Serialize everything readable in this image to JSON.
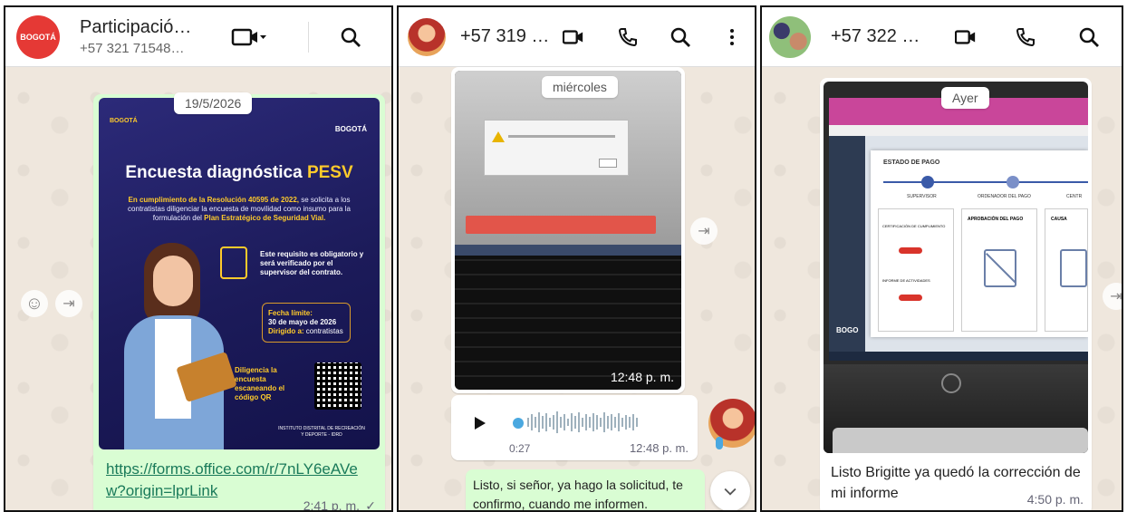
{
  "panel1": {
    "contact_name": "Participació…",
    "contact_phone": "+57 321 71548…",
    "date_pill": "19/5/2026",
    "poster": {
      "logo_text": "BOGOTÁ",
      "title_prefix": "Encuesta diagnóstica",
      "title_accent": "PESV",
      "body_1": "En cumplimiento de la Resolución 40595 de 2022,",
      "body_2": "se solicita a los contratistas diligenciar la encuesta de movilidad como insumo para la formulación del",
      "body_3": "Plan Estratégico de Seguridad Vial.",
      "req_text": "Este requisito es obligatorio y será verificado por el supervisor del contrato.",
      "deadline_label": "Fecha límite:",
      "deadline_value": "30 de mayo de 2026",
      "audience_label": "Dirigido a:",
      "audience_value": "contratistas",
      "qr_caption": "Diligencia la encuesta escaneando el código QR",
      "institute": "INSTITUTO DISTRITAL DE RECREACIÓN Y DEPORTE - IDRD"
    },
    "link_text": "https://forms.office.com/r/7nLY6eAVew?origin=lprLink",
    "link_time": "2:41 p. m.",
    "read_mark": "✓"
  },
  "panel2": {
    "contact_phone": "+57 319 …",
    "date_pill": "miércoles",
    "photo_time": "12:48 p. m.",
    "voice_duration": "0:27",
    "voice_time": "12:48 p. m.",
    "message": "Listo, si señor, ya hago la solicitud, te confirmo, cuando me informen."
  },
  "panel3": {
    "contact_phone": "+57 322 …",
    "date_pill": "Ayer",
    "screen_title": "ESTADO DE PAGO",
    "screen_col_1": "SUPERVISOR",
    "screen_col_2": "ORDENADOR DEL PAGO",
    "screen_col_3": "CENTR",
    "screen_box_2": "APROBACIÓN DEL PAGO",
    "screen_box_3": "CAUSA",
    "screen_item_1": "CERTIFICACIÓN DE CUMPLIMIENTO",
    "screen_item_2": "INFORME DE ACTIVIDADES",
    "screen_logo": "BOGO",
    "message": "Listo Brigitte ya quedó la corrección de mi informe",
    "time": "4:50 p. m."
  },
  "colors": {
    "bubble_out": "#d9fdd3",
    "chat_bg": "#efe7dd",
    "accent_yellow": "#ffcb2b"
  }
}
